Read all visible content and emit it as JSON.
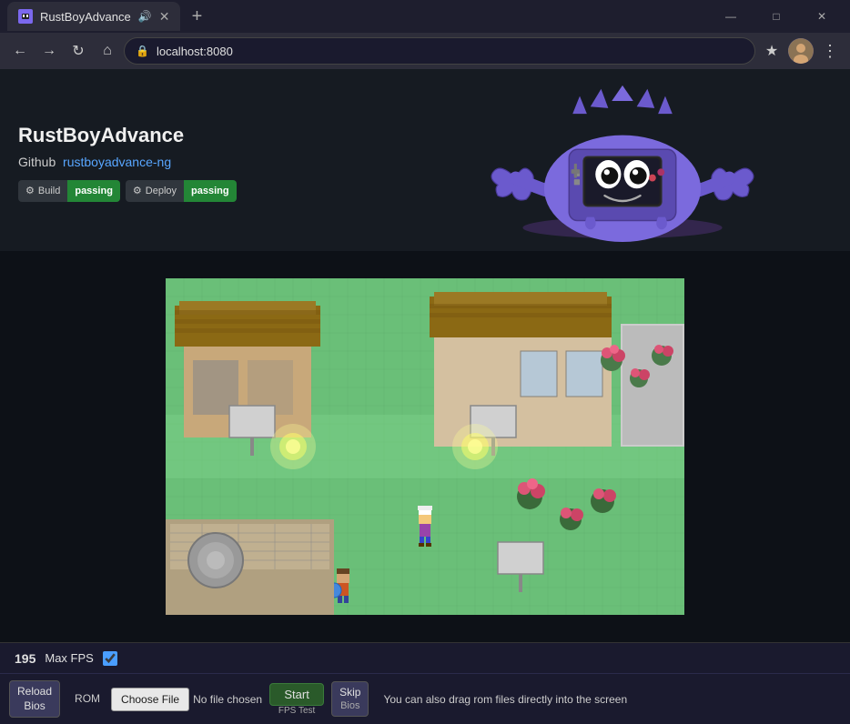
{
  "browser": {
    "tab_title": "RustBoyAdvance",
    "url": "localhost:8080",
    "new_tab_label": "+",
    "window_controls": {
      "minimize": "—",
      "maximize": "□",
      "close": "✕"
    },
    "nav": {
      "back": "←",
      "forward": "→",
      "refresh": "↻",
      "home": "⌂",
      "bookmark": "★",
      "menu": "⋮"
    }
  },
  "header": {
    "title": "RustBoyAdvance",
    "github_label": "Github",
    "github_link_text": "rustboyadvance-ng",
    "build_label": "Build",
    "build_status": "passing",
    "deploy_label": "Deploy",
    "deploy_status": "passing"
  },
  "status_bar": {
    "fps_value": "195",
    "max_fps_label": "Max FPS"
  },
  "controls": {
    "reload_bios_line1": "Reload",
    "reload_bios_line2": "Bios",
    "rom_label": "ROM",
    "choose_file": "Choose File",
    "no_file": "No file chosen",
    "start_label": "Start",
    "fps_test_label": "FPS\nTest",
    "skip_label": "Skip",
    "bios_label": "Bios",
    "drag_hint": "You can also drag rom files directly into the screen"
  }
}
